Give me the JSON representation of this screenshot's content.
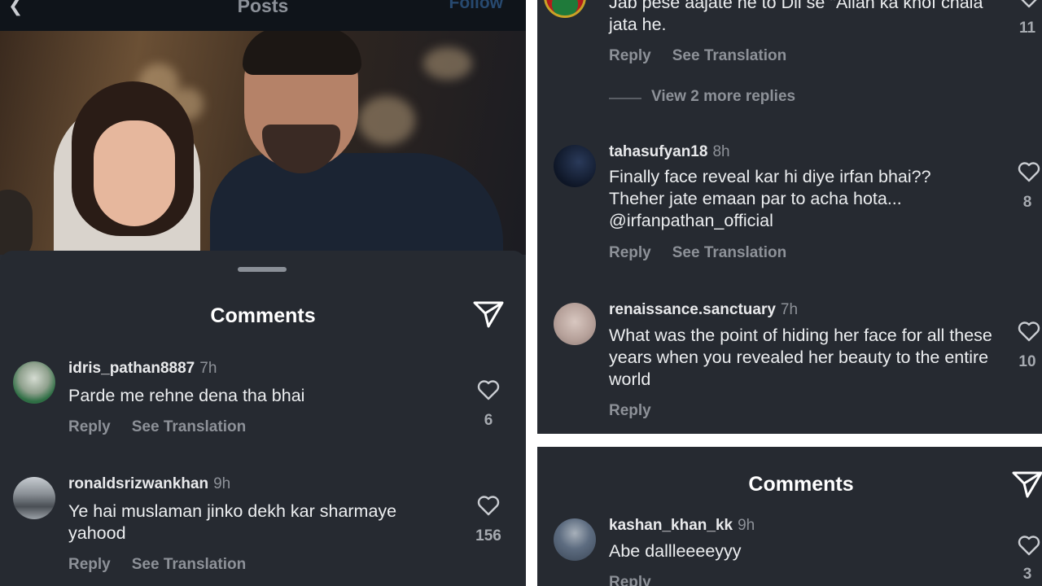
{
  "left": {
    "header": {
      "back_icon": "chevron-left-icon",
      "title": "Posts",
      "follow_label": "Follow"
    },
    "sheet": {
      "title": "Comments",
      "send_icon": "paper-plane-icon",
      "comments": [
        {
          "username": "idris_pathan8887",
          "time": "7h",
          "text": "Parde me rehne dena tha bhai",
          "reply_label": "Reply",
          "translate_label": "See Translation",
          "likes": "6"
        },
        {
          "username": "ronaldsrizwankhan",
          "time": "9h",
          "text": "Ye hai muslaman jinko dekh kar sharmaye yahood",
          "reply_label": "Reply",
          "translate_label": "See Translation",
          "likes": "156"
        }
      ]
    }
  },
  "right_top": {
    "partial_comment": {
      "text": "Jab pese aajate he to Dil se \"Allah ka khof chala jata he.",
      "reply_label": "Reply",
      "translate_label": "See Translation",
      "likes": "11"
    },
    "view_more_replies": "View 2 more replies",
    "comments": [
      {
        "username": "tahasufyan18",
        "time": "8h",
        "text": "Finally face reveal kar hi diye irfan bhai?? Theher jate emaan par to acha hota... @irfanpathan_official",
        "reply_label": "Reply",
        "translate_label": "See Translation",
        "likes": "8"
      },
      {
        "username": "renaissance.sanctuary",
        "time": "7h",
        "text": "What was the point of hiding her face for all these years when you revealed her beauty to the entire world",
        "reply_label": "Reply",
        "likes": "10"
      }
    ]
  },
  "right_bottom": {
    "title": "Comments",
    "send_icon": "paper-plane-icon",
    "comment": {
      "username": "kashan_khan_kk",
      "time": "9h",
      "text": "Abe dallleeeeyyy",
      "reply_label": "Reply",
      "likes": "3"
    }
  },
  "colors": {
    "background": "#262a31",
    "text": "#eceef0",
    "muted": "#8d9198",
    "header_bg": "#0f141a"
  }
}
